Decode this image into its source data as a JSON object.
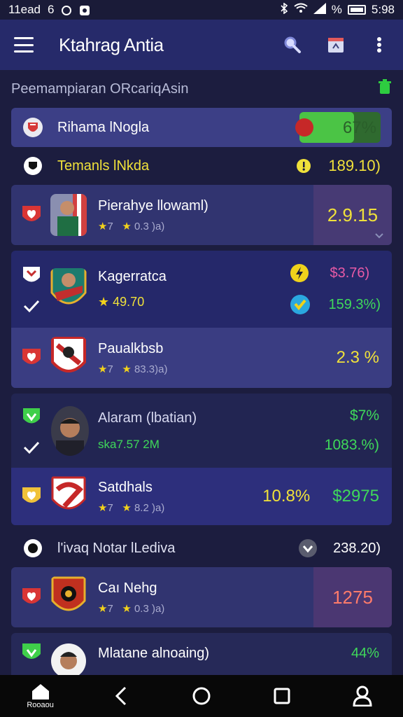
{
  "status": {
    "time_left": "11ead",
    "n1": "6",
    "time_right": "5:98",
    "pct": "%"
  },
  "appbar": {
    "title": "Ktahrag Antia"
  },
  "section": {
    "title": "Peemampiaran ORcariqAsin"
  },
  "highlight": {
    "name": "Rihama lNogla",
    "value": "67%",
    "progress": 0.67
  },
  "subheader1": {
    "label": "Temanls lNkda",
    "value": "189.10)"
  },
  "players": [
    {
      "name": "Pierahye llowaml)",
      "meta_a": "7",
      "meta_b": "0.3 )a)",
      "value": "2.9.15"
    },
    {
      "name": "Kagerratca",
      "meta_a": "49.70",
      "value_top": "$3.76)",
      "value_bottom": "159.3%)"
    },
    {
      "name": "Paualkbsb",
      "meta_a": "7",
      "meta_b": "83.3)a)",
      "value": "2.3 %"
    },
    {
      "name": "Alaram (lbatian)",
      "meta_a": "ska7.57 2M",
      "value_top": "$7%",
      "value_bottom": "1083.%)"
    },
    {
      "name": "Satdhals",
      "meta_a": "7",
      "meta_b": "8.2 )a)",
      "value_a": "10.8%",
      "value_b": "$2975"
    }
  ],
  "subheader2": {
    "label": "l'ivaq Notar lLediva",
    "value": "238.20)"
  },
  "players2": [
    {
      "name": "Caı Nehg",
      "meta_a": "7",
      "meta_b": "0.3 )a)",
      "value": "1275"
    },
    {
      "name": "Mlatane alnoaing)",
      "value": "44%"
    }
  ],
  "nav": {
    "home_label": "Rooaou"
  },
  "colors": {
    "bg": "#1c1d3f",
    "card": "#313470",
    "accent_green": "#3fd95a",
    "accent_yellow": "#f0e13a"
  }
}
